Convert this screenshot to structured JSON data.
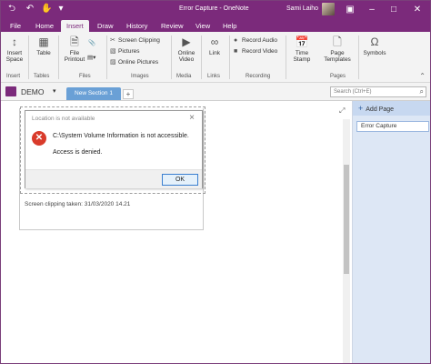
{
  "titlebar": {
    "title": "Error Capture  -  OneNote",
    "user": "Sami Laiho",
    "colors": {
      "accent": "#7b2a7b"
    }
  },
  "ribbon_tabs": [
    "File",
    "Home",
    "Insert",
    "Draw",
    "History",
    "Review",
    "View",
    "Help"
  ],
  "active_tab": "Insert",
  "ribbon": {
    "insert_space": "Insert\nSpace",
    "table": "Table",
    "file_printout": "File\nPrintout",
    "screen_clipping": "Screen Clipping",
    "pictures": "Pictures",
    "online_pictures": "Online Pictures",
    "online_video": "Online\nVideo",
    "link": "Link",
    "record_audio": "Record Audio",
    "record_video": "Record Video",
    "time_stamp": "Time\nStamp",
    "page_templates": "Page\nTemplates",
    "symbols": "Symbols",
    "groups": [
      "Insert",
      "Tables",
      "Files",
      "Images",
      "Media",
      "Links",
      "Recording",
      "Pages"
    ]
  },
  "notebook": {
    "name": "DEMO",
    "section_tab": "New Section 1",
    "add_section": "+",
    "search_placeholder": "Search (Ctrl+E)"
  },
  "dialog": {
    "title": "Location is not available",
    "message_line1": "C:\\System Volume Information is not accessible.",
    "message_line2": "Access is denied.",
    "ok_label": "OK"
  },
  "caption": "Screen clipping taken: 31/03/2020 14.21",
  "pages_pane": {
    "add_page": "Add Page",
    "pages": [
      "Error Capture"
    ]
  }
}
